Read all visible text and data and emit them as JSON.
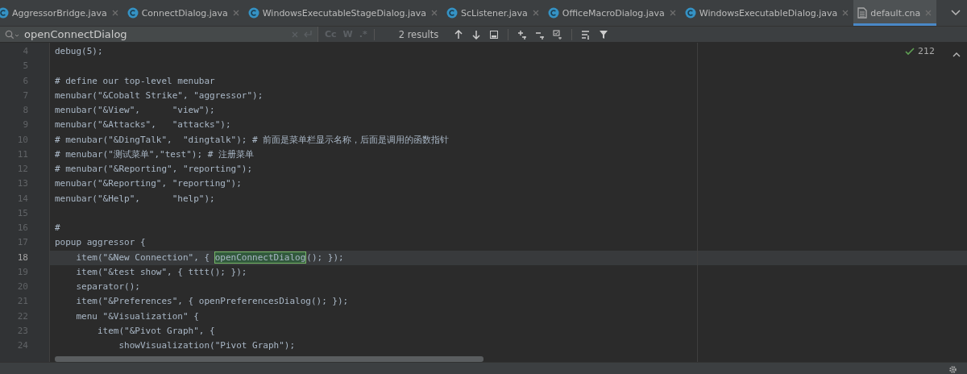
{
  "tabs": [
    {
      "label": "AggressorBridge.java",
      "kind": "class",
      "selected": false
    },
    {
      "label": "ConnectDialog.java",
      "kind": "class",
      "selected": false
    },
    {
      "label": "WindowsExecutableStageDialog.java",
      "kind": "class",
      "selected": false
    },
    {
      "label": "ScListener.java",
      "kind": "class",
      "selected": false
    },
    {
      "label": "OfficeMacroDialog.java",
      "kind": "class",
      "selected": false
    },
    {
      "label": "WindowsExecutableDialog.java",
      "kind": "class",
      "selected": false
    },
    {
      "label": "default.cna",
      "kind": "file",
      "selected": true
    }
  ],
  "search": {
    "value": "openConnectDialog",
    "case_label": "Cc",
    "word_label": "W",
    "regex_label": ".*",
    "results": "2 results"
  },
  "inspection": {
    "count": "212"
  },
  "lines": [
    {
      "number": "4",
      "code": "debug(5);",
      "current": false
    },
    {
      "number": "5",
      "current": false
    },
    {
      "number": "6",
      "code": "# define our top-level menubar",
      "current": false
    },
    {
      "number": "7",
      "code": "menubar(\"&Cobalt Strike\", \"aggressor\");",
      "current": false
    },
    {
      "number": "8",
      "code": "menubar(\"&View\",      \"view\");",
      "current": false
    },
    {
      "number": "9",
      "code": "menubar(\"&Attacks\",   \"attacks\");",
      "current": false
    },
    {
      "number": "10",
      "code": "# menubar(\"&DingTalk\",  \"dingtalk\"); # 前面是菜单栏显示名称，后面是调用的函数指针",
      "current": false
    },
    {
      "number": "11",
      "code": "# menubar(\"测试菜单\",\"test\"); # 注册菜单",
      "current": false
    },
    {
      "number": "12",
      "code": "# menubar(\"&Reporting\", \"reporting\");",
      "current": false
    },
    {
      "number": "13",
      "code": "menubar(\"&Reporting\", \"reporting\");",
      "current": false
    },
    {
      "number": "14",
      "code": "menubar(\"&Help\",      \"help\");",
      "current": false
    },
    {
      "number": "15",
      "current": false
    },
    {
      "number": "16",
      "code": "#",
      "current": false
    },
    {
      "number": "17",
      "code": "popup aggressor {",
      "current": false
    },
    {
      "number": "18",
      "code": "    item(\"&New Connection\", { ",
      "match": "openConnectDialog",
      "after": "(); });",
      "current": true
    },
    {
      "number": "19",
      "code": "    item(\"&test show\", { tttt(); });",
      "current": false
    },
    {
      "number": "20",
      "code": "    separator();",
      "current": false
    },
    {
      "number": "21",
      "code": "    item(\"&Preferences\", { openPreferencesDialog(); });",
      "current": false
    },
    {
      "number": "22",
      "code": "    menu \"&Visualization\" {",
      "current": false
    },
    {
      "number": "23",
      "code": "        item(\"&Pivot Graph\", {",
      "current": false
    },
    {
      "number": "24",
      "code": "            showVisualization(\"Pivot Graph\");",
      "current": false
    }
  ]
}
